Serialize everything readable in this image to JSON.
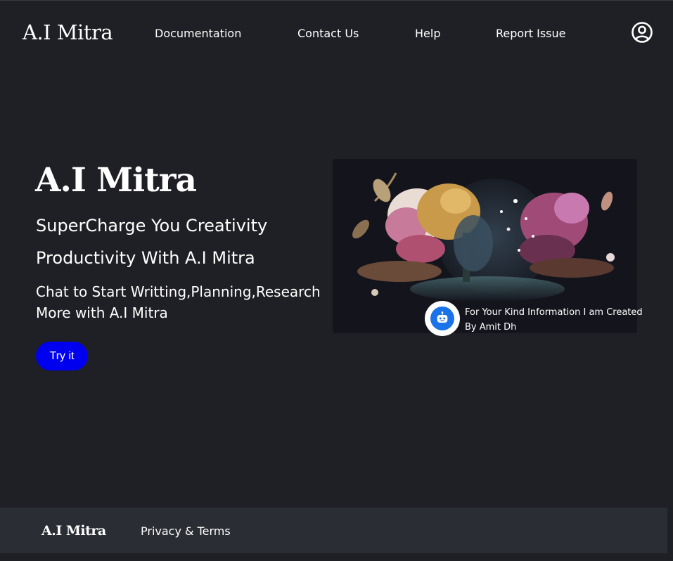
{
  "nav": {
    "logo": "A.I Mitra",
    "links": [
      "Documentation",
      "Contact Us",
      "Help",
      "Report Issue"
    ],
    "user_icon": "user-circle-icon"
  },
  "hero": {
    "title": "A.I Mitra",
    "tagline_line1": "SuperCharge You Creativity",
    "tagline_line2": "Productivity With A.I Mitra",
    "description_line1": "Chat to Start Writting,Planning,Research",
    "description_line2": "More with A.I Mitra",
    "cta_label": "Try it"
  },
  "bot_note": {
    "icon": "robot-icon",
    "line1": "For Your Kind Information I am Created",
    "line2": "By Amit Dh"
  },
  "footer": {
    "logo": "A.I Mitra",
    "link": "Privacy & Terms"
  },
  "colors": {
    "background": "#1f2025",
    "footer_background": "#2a2d33",
    "cta": "#0000ee",
    "bot_accent": "#1a73e8"
  }
}
